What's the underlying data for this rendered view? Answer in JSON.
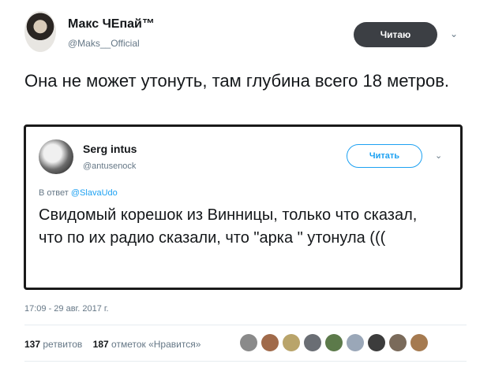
{
  "author": {
    "name": "Макс ЧЕпай™",
    "handle": "@Maks__Official",
    "follow_label": "Читаю"
  },
  "tweet": {
    "text": "Она не может утонуть, там глубина всего 18 метров."
  },
  "quoted": {
    "name": "Serg intus",
    "handle": "@antusenock",
    "follow_label": "Читать",
    "reply_prefix": "В ответ",
    "reply_mention": "@SlavaUdo",
    "text": "Свидомый корешок из Винницы, только что сказал, что по их радио  сказали, что \"арка \" утонула ((("
  },
  "timestamp": "17:09 - 29 авг. 2017 г.",
  "stats": {
    "retweets_count": "137",
    "retweets_label": "ретвитов",
    "likes_count": "187",
    "likes_label": "отметок «Нравится»"
  },
  "colors": {
    "accent": "#1da1f2",
    "follow_bg": "#3c3f44",
    "muted": "#657786"
  },
  "likers": [
    "#8a8a8a",
    "#a06a4a",
    "#b9a46a",
    "#6a6e74",
    "#5c7a4a",
    "#9aa7b8",
    "#3c3c3c",
    "#7a6a5a",
    "#a57a50"
  ]
}
